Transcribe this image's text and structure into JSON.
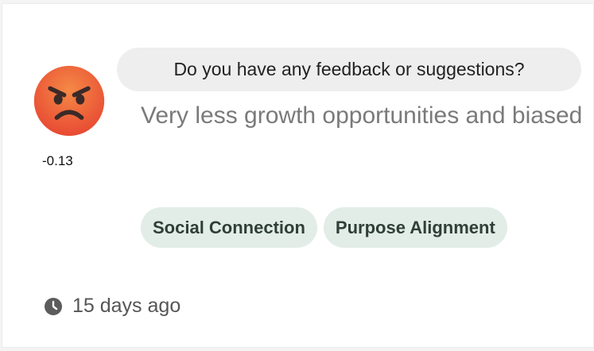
{
  "feedback": {
    "sentiment_icon": "angry-face-icon",
    "sentiment_score": "-0.13",
    "question": "Do you have any feedback or suggestions?",
    "answer": "Very less growth opportunities and biased",
    "tags": [
      "Social Connection",
      "Purpose Alignment"
    ],
    "time_icon": "clock-icon",
    "timestamp": "15 days ago"
  },
  "colors": {
    "emoji_face": "#ec5b3a",
    "tag_background": "#e2ede7",
    "bubble_background": "#eeeeee"
  }
}
